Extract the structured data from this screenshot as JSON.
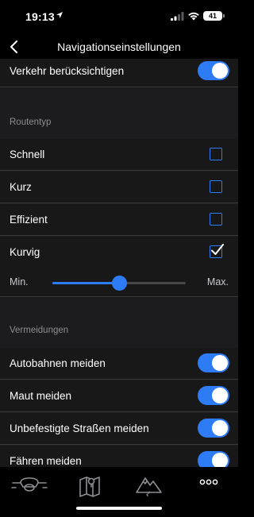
{
  "status_bar": {
    "time": "19:13",
    "battery": "41"
  },
  "nav": {
    "title": "Navigationseinstellungen"
  },
  "rows": {
    "traffic": {
      "label": "Verkehr berücksichtigen",
      "on": true
    }
  },
  "route_type": {
    "header": "Routentyp",
    "options": [
      {
        "label": "Schnell",
        "checked": false
      },
      {
        "label": "Kurz",
        "checked": false
      },
      {
        "label": "Effizient",
        "checked": false
      },
      {
        "label": "Kurvig",
        "checked": true
      }
    ],
    "curviness": {
      "min_label": "Min.",
      "max_label": "Max.",
      "value": 0.5
    }
  },
  "avoidances": {
    "header": "Vermeidungen",
    "items": [
      {
        "label": "Autobahnen meiden",
        "on": true
      },
      {
        "label": "Maut meiden",
        "on": true
      },
      {
        "label": "Unbefestigte Straßen meiden",
        "on": true
      },
      {
        "label": "Fähren meiden",
        "on": true
      }
    ]
  },
  "tab_bar": {
    "tabs": [
      {
        "icon": "motorcycle-icon"
      },
      {
        "icon": "map-icon"
      },
      {
        "icon": "mountain-road-icon"
      },
      {
        "icon": "more-icon"
      }
    ]
  },
  "colors": {
    "accent": "#2d7cf6",
    "background": "#1c1c1e",
    "row": "#181818"
  }
}
